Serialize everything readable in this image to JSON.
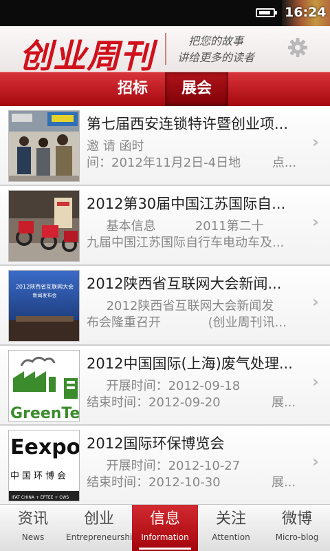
{
  "status_bar": {
    "time": "16:24"
  },
  "header": {
    "logo": "创业周刊",
    "slogan_line1": "把您的故事",
    "slogan_line2": "讲给更多的读者"
  },
  "tabs": [
    {
      "label": "招标",
      "active": false
    },
    {
      "label": "展会",
      "active": true
    }
  ],
  "items": [
    {
      "title": "第七届西安连锁特许暨创业项...",
      "line1": "邀 请 函时",
      "line2": "间：2012年11月2日-4日地        点..."
    },
    {
      "title": "2012第30届中国江苏国际自...",
      "line1": "     基本信息          2011第二十",
      "line2": "九届中国江苏国际自行车电动车及..."
    },
    {
      "title": "2012陕西省互联网大会新闻...",
      "line1": "     2012陕西省互联网大会新闻发",
      "line2": "布会隆重召开            (创业周刊讯..."
    },
    {
      "title": "2012中国国际(上海)废气处理...",
      "line1": "     开展时间：2012-09-18",
      "line2": "结束时间：2012-09-20             展..."
    },
    {
      "title": "2012国际环保博览会",
      "line1": "     开展时间：2012-10-27",
      "line2": "结束时间：2012-10-30             展..."
    }
  ],
  "thumb_texts": {
    "t3_banner": "2012陕西省互联网大会",
    "t3_sub": "新闻发布会",
    "t4_word": "GreenTech",
    "t5_logo": "Eexpo",
    "t5_cn": "中国环博会",
    "t5_small": "IFAT CHINA + EPTEE + CWS"
  },
  "bottom_nav": [
    {
      "zh": "资讯",
      "en": "News",
      "active": false
    },
    {
      "zh": "创业",
      "en": "Entrepreneurship",
      "active": false
    },
    {
      "zh": "信息",
      "en": "Information",
      "active": true
    },
    {
      "zh": "关注",
      "en": "Attention",
      "active": false
    },
    {
      "zh": "微博",
      "en": "Micro-blog",
      "active": false
    }
  ],
  "colors": {
    "brand_red": "#d0101a",
    "tab_bar": "#c21b22"
  }
}
